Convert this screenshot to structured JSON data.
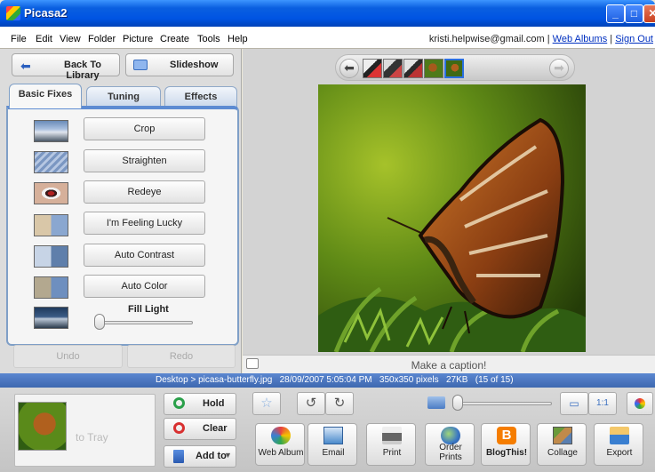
{
  "app": {
    "title": "Picasa2"
  },
  "window_controls": {
    "minimize": "_",
    "maximize": "□",
    "close": "✕"
  },
  "menu": [
    "File",
    "Edit",
    "View",
    "Folder",
    "Picture",
    "Create",
    "Tools",
    "Help"
  ],
  "account": {
    "email": "kristi.helpwise@gmail.com",
    "sep": "|",
    "web_albums": "Web Albums",
    "sign_out": "Sign Out"
  },
  "nav": {
    "back": "Back To Library",
    "slideshow": "Slideshow"
  },
  "tabs": [
    "Basic Fixes",
    "Tuning",
    "Effects"
  ],
  "fixes": [
    "Crop",
    "Straighten",
    "Redeye",
    "I'm Feeling Lucky",
    "Auto Contrast",
    "Auto Color"
  ],
  "fill_light": {
    "label": "Fill Light",
    "value": 0
  },
  "history": {
    "undo": "Undo",
    "redo": "Redo"
  },
  "caption": {
    "placeholder": "Make a caption!"
  },
  "status": {
    "text": "Desktop > picasa-butterfly.jpg   28/09/2007 5:05:04 PM   350x350 pixels   27KB   (15 of 15)"
  },
  "tray": {
    "placeholder": "to Tray",
    "hold": "Hold",
    "clear": "Clear",
    "add_to": "Add to"
  },
  "zoom_buttons": {
    "fit": "▭",
    "actual": "1:1"
  },
  "actions": [
    {
      "label": "Web Album",
      "icon": "web-album-icon",
      "color": "#3b7fd4"
    },
    {
      "label": "Email",
      "icon": "email-icon",
      "color": "#4a8acb"
    },
    {
      "label": "Print",
      "icon": "print-icon",
      "color": "#555555"
    },
    {
      "label": "Order Prints",
      "icon": "order-prints-icon",
      "color": "#3a77c5"
    },
    {
      "label": "BlogThis!",
      "icon": "blogger-icon",
      "color": "#f57d00"
    },
    {
      "label": "Collage",
      "icon": "collage-icon",
      "color": "#8a6a3a"
    },
    {
      "label": "Export",
      "icon": "export-icon",
      "color": "#3a7fd0"
    }
  ],
  "colors": {
    "title_bar": "#0054e3",
    "status_bar": "#4a78c2",
    "tab_accent": "#5d8bd2",
    "blogger": "#f57d00"
  }
}
